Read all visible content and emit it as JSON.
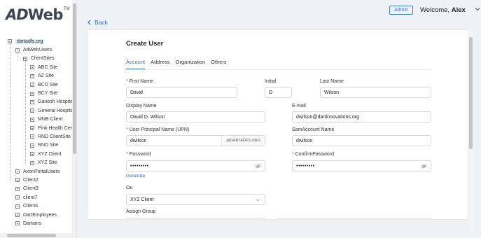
{
  "brand": {
    "logo_ad": "AD",
    "logo_web": "Web",
    "logo_tm": "TM"
  },
  "header": {
    "admin_badge": "Admin",
    "welcome_text": "Welcome,",
    "user_name": "Alex"
  },
  "back_label": "Back",
  "tree": {
    "root": "dartadfs.org",
    "group": "AdWebUsers",
    "subgroup": "ClientSites",
    "sites": [
      "ABC Site",
      "AZ Site",
      "BCD Site",
      "BCY Site",
      "Ganesh Hospita",
      "General Hospita",
      "MNB Client",
      "Pink Health Cen",
      "RND ClientSite",
      "RND Site",
      "XYZ Client",
      "XYZ Site"
    ],
    "top_items": [
      "AxonPortalUsers",
      "Client2",
      "Client3",
      "client7",
      "Clients",
      "DartEmployees",
      "Dartians"
    ]
  },
  "form": {
    "title": "Create User",
    "tabs": [
      "Account",
      "Address",
      "Organization",
      "Others"
    ],
    "first_name_label": "First Name",
    "first_name_value": "David",
    "initial_label": "Initial",
    "initial_value": "D",
    "last_name_label": "Last Name",
    "last_name_value": "Wilson",
    "display_name_label": "Display Name",
    "display_name_value": "David D. Wilson",
    "email_label": "E-mail",
    "email_value": "dwilson@dartinnovations.org",
    "upn_label": "User Principal Name (UPN)",
    "upn_value": "dwilson",
    "upn_suffix": "@DARTADFS.ORG",
    "sam_label": "SamAccount Name",
    "sam_value": "dwilson",
    "password_label": "Password",
    "password_value": "•••••••••",
    "confirm_label": "ConfirmPassword",
    "confirm_value": "•••••••••",
    "generate_label": "Generate",
    "ou_label": "Ou",
    "ou_value": "XYZ Client",
    "assign_group_label": "Assign Group",
    "required_mark": "*"
  },
  "colors": {
    "accent": "#2f6fd0",
    "required": "#e0443e",
    "background": "#eef1f6"
  }
}
